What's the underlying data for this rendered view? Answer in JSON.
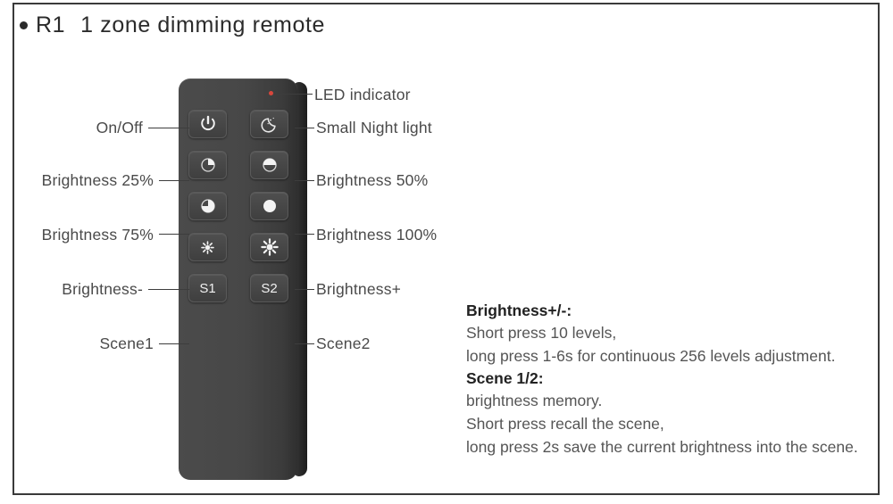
{
  "header": {
    "bullet": "●",
    "model": "R1",
    "title": "1 zone dimming remote",
    "full_title": "R1   1 zone dimming remote"
  },
  "device": {
    "name": "R1 1 zone dimming remote",
    "body_color": "#474747",
    "led_color": "#d8473c",
    "led_name": "LED indicator"
  },
  "callouts": {
    "led": "LED indicator",
    "left": [
      {
        "key": "on_off",
        "label": "On/Off"
      },
      {
        "key": "brightness_25",
        "label": "Brightness 25%"
      },
      {
        "key": "brightness_75",
        "label": "Brightness 75%"
      },
      {
        "key": "brightness_down",
        "label": "Brightness-"
      },
      {
        "key": "scene1",
        "label": "Scene1"
      }
    ],
    "right": [
      {
        "key": "night_light",
        "label": "Small Night light"
      },
      {
        "key": "brightness_50",
        "label": "Brightness 50%"
      },
      {
        "key": "brightness_100",
        "label": "Brightness 100%"
      },
      {
        "key": "brightness_up",
        "label": "Brightness+"
      },
      {
        "key": "scene2",
        "label": "Scene2"
      }
    ]
  },
  "buttons": {
    "row1": [
      {
        "key": "on_off",
        "icon": "power-icon",
        "text": ""
      },
      {
        "key": "night_light",
        "icon": "moon-icon",
        "text": ""
      }
    ],
    "row2": [
      {
        "key": "brightness_25",
        "icon": "pie-25-icon",
        "text": ""
      },
      {
        "key": "brightness_50",
        "icon": "pie-50-icon",
        "text": ""
      }
    ],
    "row3": [
      {
        "key": "brightness_75",
        "icon": "pie-75-icon",
        "text": ""
      },
      {
        "key": "brightness_100",
        "icon": "pie-100-icon",
        "text": ""
      }
    ],
    "row4": [
      {
        "key": "brightness_down",
        "icon": "sun-small-icon",
        "text": ""
      },
      {
        "key": "brightness_up",
        "icon": "sun-large-icon",
        "text": ""
      }
    ],
    "row5": [
      {
        "key": "scene1",
        "icon": "",
        "text": "S1"
      },
      {
        "key": "scene2",
        "icon": "",
        "text": "S2"
      }
    ]
  },
  "notes": {
    "brightness": {
      "heading": "Brightness+/-:",
      "lines": [
        "Short press 10 levels,",
        "long press 1-6s for continuous 256 levels adjustment."
      ]
    },
    "scene": {
      "heading": "Scene 1/2:",
      "lines": [
        "brightness memory.",
        "Short press recall the scene,",
        "long press 2s save the current brightness into the scene."
      ]
    }
  }
}
